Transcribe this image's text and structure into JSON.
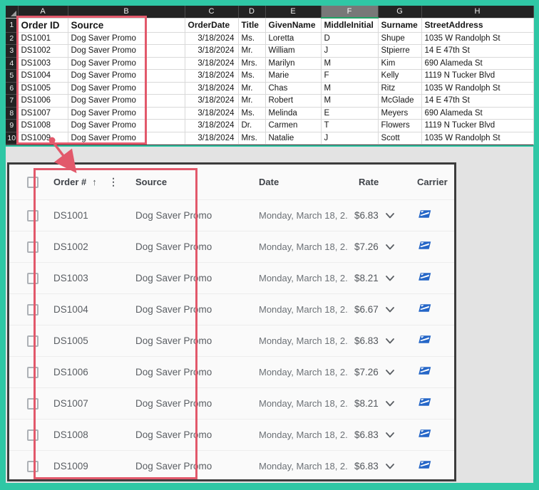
{
  "colors": {
    "frame_teal": "#2FC7A5",
    "annotation_red": "#E2596B",
    "excel_header_bg": "#232323",
    "excel_selected_green": "#21A366",
    "panel_bg": "#FAFAFA",
    "canvas_gray": "#E3E3E3",
    "usps_blue": "#2566C7"
  },
  "excel": {
    "column_letters": [
      "A",
      "B",
      "C",
      "D",
      "E",
      "F",
      "G",
      "H"
    ],
    "selected_column": "F",
    "header_row_number": "1",
    "header_row": [
      "Order ID",
      "Source",
      "OrderDate",
      "Title",
      "GivenName",
      "MiddleInitial",
      "Surname",
      "StreetAddress"
    ],
    "rows": [
      {
        "n": "2",
        "cells": [
          "DS1001",
          "Dog Saver Promo",
          "3/18/2024",
          "Ms.",
          "Loretta",
          "D",
          "Shupe",
          "1035 W Randolph St"
        ]
      },
      {
        "n": "3",
        "cells": [
          "DS1002",
          "Dog Saver Promo",
          "3/18/2024",
          "Mr.",
          "William",
          "J",
          "Stpierre",
          "14 E 47th St"
        ]
      },
      {
        "n": "4",
        "cells": [
          "DS1003",
          "Dog Saver Promo",
          "3/18/2024",
          "Mrs.",
          "Marilyn",
          "M",
          "Kim",
          "690 Alameda St"
        ]
      },
      {
        "n": "5",
        "cells": [
          "DS1004",
          "Dog Saver Promo",
          "3/18/2024",
          "Ms.",
          "Marie",
          "F",
          "Kelly",
          "1119 N Tucker Blvd"
        ]
      },
      {
        "n": "6",
        "cells": [
          "DS1005",
          "Dog Saver Promo",
          "3/18/2024",
          "Mr.",
          "Chas",
          "M",
          "Ritz",
          "1035 W Randolph St"
        ]
      },
      {
        "n": "7",
        "cells": [
          "DS1006",
          "Dog Saver Promo",
          "3/18/2024",
          "Mr.",
          "Robert",
          "M",
          "McGlade",
          "14 E 47th St"
        ]
      },
      {
        "n": "8",
        "cells": [
          "DS1007",
          "Dog Saver Promo",
          "3/18/2024",
          "Ms.",
          "Melinda",
          "E",
          "Meyers",
          "690 Alameda St"
        ]
      },
      {
        "n": "9",
        "cells": [
          "DS1008",
          "Dog Saver Promo",
          "3/18/2024",
          "Dr.",
          "Carmen",
          "T",
          "Flowers",
          "1119 N Tucker Blvd"
        ]
      },
      {
        "n": "10",
        "cells": [
          "DS1009",
          "Dog Saver Promo",
          "3/18/2024",
          "Mrs.",
          "Natalie",
          "J",
          "Scott",
          "1035 W Randolph St"
        ]
      }
    ]
  },
  "orders_panel": {
    "headers": {
      "order": "Order #",
      "source": "Source",
      "date": "Date",
      "rate": "Rate",
      "carrier": "Carrier"
    },
    "sort_icon": "↑",
    "menu_icon": "⋮",
    "rows": [
      {
        "order": "DS1001",
        "source": "Dog Saver Promo",
        "date": "Monday, March 18, 2...",
        "rate": "$6.83"
      },
      {
        "order": "DS1002",
        "source": "Dog Saver Promo",
        "date": "Monday, March 18, 2...",
        "rate": "$7.26"
      },
      {
        "order": "DS1003",
        "source": "Dog Saver Promo",
        "date": "Monday, March 18, 2...",
        "rate": "$8.21"
      },
      {
        "order": "DS1004",
        "source": "Dog Saver Promo",
        "date": "Monday, March 18, 2...",
        "rate": "$6.67"
      },
      {
        "order": "DS1005",
        "source": "Dog Saver Promo",
        "date": "Monday, March 18, 2...",
        "rate": "$6.83"
      },
      {
        "order": "DS1006",
        "source": "Dog Saver Promo",
        "date": "Monday, March 18, 2...",
        "rate": "$7.26"
      },
      {
        "order": "DS1007",
        "source": "Dog Saver Promo",
        "date": "Monday, March 18, 2...",
        "rate": "$8.21"
      },
      {
        "order": "DS1008",
        "source": "Dog Saver Promo",
        "date": "Monday, March 18, 2...",
        "rate": "$6.83"
      },
      {
        "order": "DS1009",
        "source": "Dog Saver Promo",
        "date": "Monday, March 18, 2...",
        "rate": "$6.83"
      }
    ]
  }
}
